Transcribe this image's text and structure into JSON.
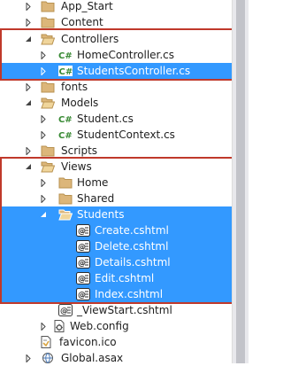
{
  "tree": {
    "items": [
      {
        "label": "App_Start",
        "icon": "folder-icon",
        "expander": "collapsed"
      },
      {
        "label": "Content",
        "icon": "folder-icon",
        "expander": "collapsed"
      },
      {
        "label": "Controllers",
        "icon": "folder-open-icon",
        "expander": "expanded"
      },
      {
        "label": "HomeController.cs",
        "icon": "csharp-file-icon",
        "expander": "collapsed"
      },
      {
        "label": "StudentsController.cs",
        "icon": "csharp-file-icon",
        "expander": "collapsed",
        "selected": true
      },
      {
        "label": "fonts",
        "icon": "folder-icon",
        "expander": "collapsed"
      },
      {
        "label": "Models",
        "icon": "folder-open-icon",
        "expander": "expanded"
      },
      {
        "label": "Student.cs",
        "icon": "csharp-file-icon",
        "expander": "collapsed"
      },
      {
        "label": "StudentContext.cs",
        "icon": "csharp-file-icon",
        "expander": "collapsed"
      },
      {
        "label": "Scripts",
        "icon": "folder-icon",
        "expander": "collapsed"
      },
      {
        "label": "Views",
        "icon": "folder-open-icon",
        "expander": "expanded"
      },
      {
        "label": "Home",
        "icon": "folder-icon",
        "expander": "collapsed"
      },
      {
        "label": "Shared",
        "icon": "folder-icon",
        "expander": "collapsed"
      },
      {
        "label": "Students",
        "icon": "folder-open-icon",
        "expander": "expanded",
        "selected": true
      },
      {
        "label": "Create.cshtml",
        "icon": "cshtml-file-icon",
        "expander": "none",
        "selected": true
      },
      {
        "label": "Delete.cshtml",
        "icon": "cshtml-file-icon",
        "expander": "none",
        "selected": true
      },
      {
        "label": "Details.cshtml",
        "icon": "cshtml-file-icon",
        "expander": "none",
        "selected": true
      },
      {
        "label": "Edit.cshtml",
        "icon": "cshtml-file-icon",
        "expander": "none",
        "selected": true
      },
      {
        "label": "Index.cshtml",
        "icon": "cshtml-file-icon",
        "expander": "none",
        "selected": true
      },
      {
        "label": "_ViewStart.cshtml",
        "icon": "cshtml-file-icon",
        "expander": "none"
      },
      {
        "label": "Web.config",
        "icon": "config-file-icon",
        "expander": "collapsed"
      },
      {
        "label": "favicon.ico",
        "icon": "favicon-file-icon",
        "expander": "none"
      },
      {
        "label": "Global.asax",
        "icon": "asax-file-icon",
        "expander": "collapsed"
      }
    ]
  },
  "colors": {
    "selection": "#3399ff",
    "highlight_border": "#c0392b",
    "folder": "#dcb67a",
    "csharp": "#388a34"
  }
}
